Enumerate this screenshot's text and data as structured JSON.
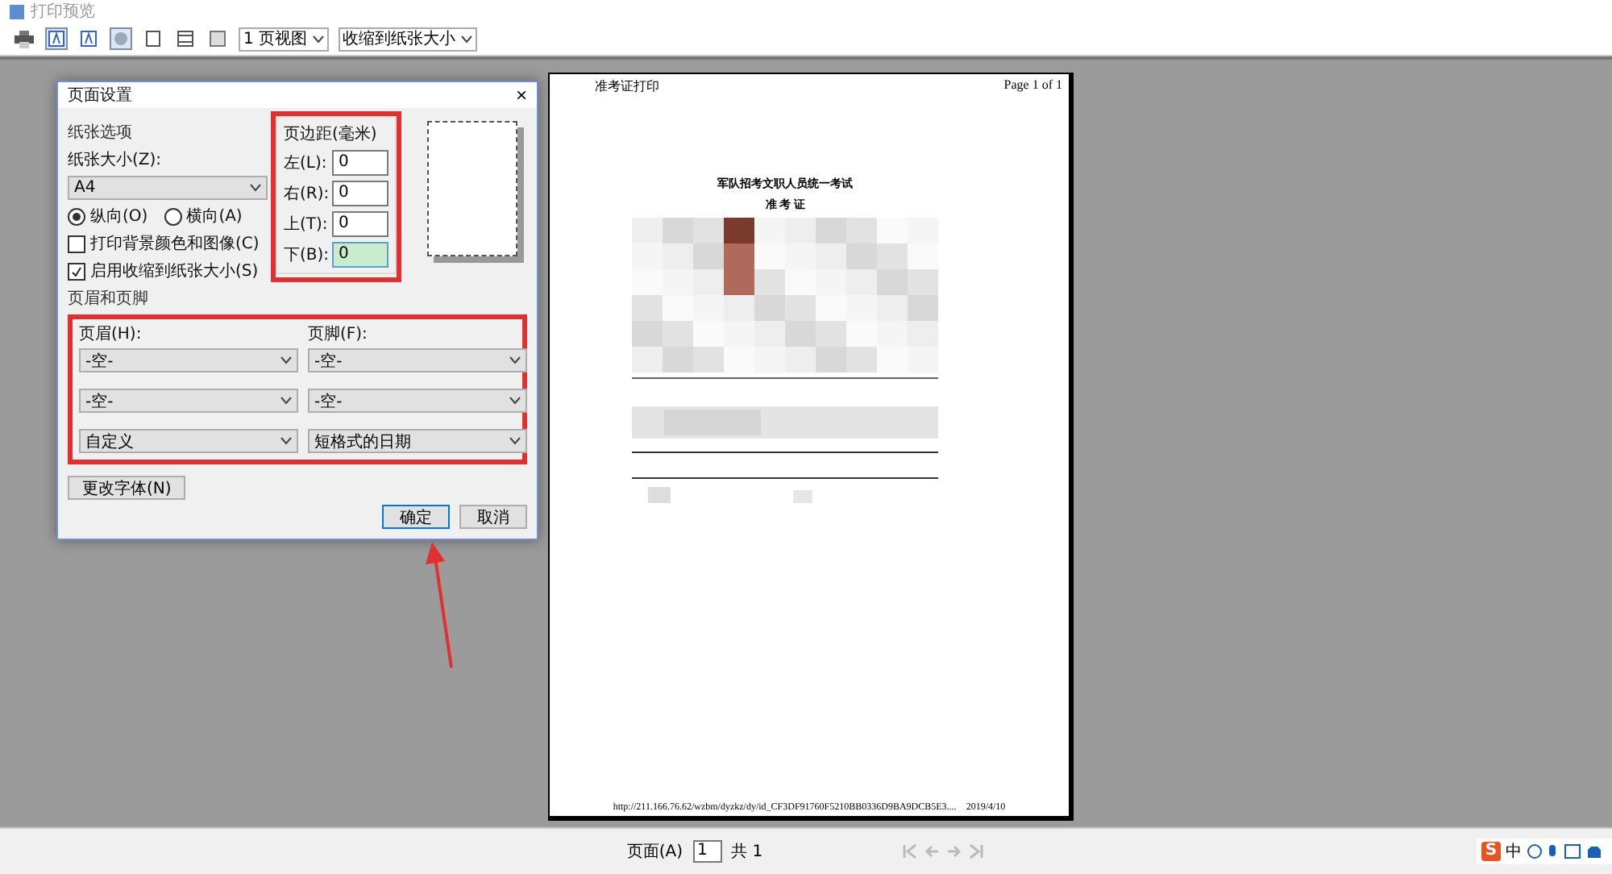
{
  "window": {
    "title": "打印预览"
  },
  "toolbar": {
    "tools": [
      {
        "kind": "print",
        "pressed": false
      },
      {
        "kind": "text-large",
        "pressed": true
      },
      {
        "kind": "text-small",
        "pressed": false
      },
      {
        "kind": "circle",
        "pressed": true
      },
      {
        "kind": "page",
        "pressed": false
      },
      {
        "kind": "header",
        "pressed": false
      },
      {
        "kind": "full",
        "pressed": false
      }
    ],
    "selects": [
      "1 页视图",
      "收缩到纸张大小"
    ]
  },
  "dialog": {
    "title": "页面设置",
    "close": "×",
    "paper": {
      "group_label": "纸张选项",
      "size_label": "纸张大小(Z):",
      "size_value": "A4",
      "orientation": [
        {
          "label": "纵向(O)",
          "selected": true
        },
        {
          "label": "横向(A)",
          "selected": false
        }
      ],
      "options": [
        {
          "label": "打印背景颜色和图像(C)",
          "checked": false
        },
        {
          "label": "启用收缩到纸张大小(S)",
          "checked": true
        }
      ]
    },
    "margins": {
      "group_label": "页边距(毫米)",
      "fields": [
        {
          "label": "左(L):",
          "value": "0",
          "focused": false
        },
        {
          "label": "右(R):",
          "value": "0",
          "focused": false
        },
        {
          "label": "上(T):",
          "value": "0",
          "focused": false
        },
        {
          "label": "下(B):",
          "value": "0",
          "focused": true
        }
      ]
    },
    "header_footer": {
      "group_label": "页眉和页脚",
      "header_label": "页眉(H):",
      "footer_label": "页脚(F):",
      "header_values": [
        "-空-",
        "-空-",
        "自定义"
      ],
      "footer_values": [
        "-空-",
        "-空-",
        "短格式的日期"
      ]
    },
    "font_button": "更改字体(N)",
    "buttons": [
      {
        "label": "确定",
        "default": true
      },
      {
        "label": "取消",
        "default": false
      }
    ]
  },
  "page": {
    "header_left": "准考证打印",
    "header_right": "Page 1 of 1",
    "title": "军队招考文职人员统一考试",
    "subtitle": "准 考 证",
    "footer_url": "http://211.166.76.62/wzbm/dyzkz/dy/id_CF3DF91760F5210BB0336D9BA9DCB5E3....",
    "footer_date": "2019/4/10"
  },
  "pager": {
    "label": "页面(A)",
    "value": "1",
    "total": "共 1"
  },
  "ime": {
    "logo": "S",
    "mode": "中"
  }
}
